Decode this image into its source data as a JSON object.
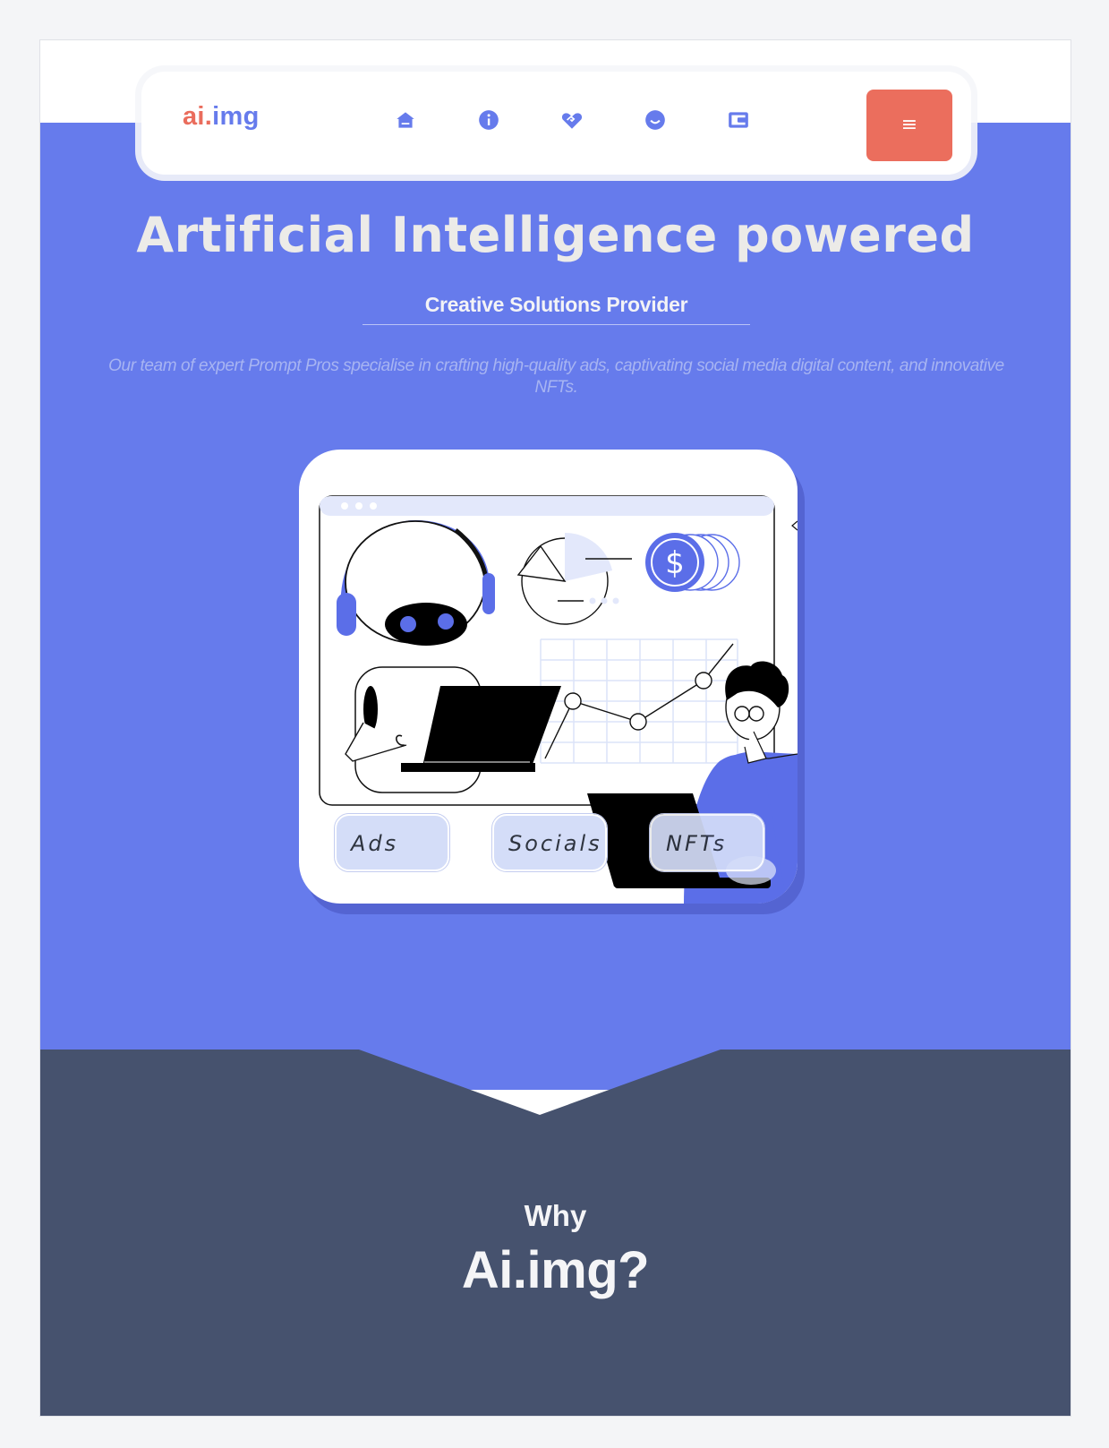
{
  "brand": {
    "logo_part1": "ai",
    "logo_dot": ".",
    "logo_part2": "img"
  },
  "nav": {
    "icons": [
      "home-icon",
      "info-icon",
      "handshake-icon",
      "smile-icon",
      "wallet-icon"
    ],
    "menu_icon": "≡"
  },
  "hero": {
    "title": "Artificial Intelligence powered",
    "subtitle": "Creative Solutions Provider",
    "description": "Our team of expert Prompt Pros specialise in crafting high-quality ads, captivating social media digital content, and innovative NFTs."
  },
  "illustration": {
    "pills": [
      "Ads",
      "Socials",
      "NFTs"
    ],
    "coin_symbol": "$"
  },
  "why": {
    "label": "Why",
    "brand": "Ai.img?"
  },
  "colors": {
    "hero_bg": "#667bec",
    "dark_bg": "#46526e",
    "accent_orange": "#eb6e5d",
    "logo_blue": "#667bec"
  }
}
